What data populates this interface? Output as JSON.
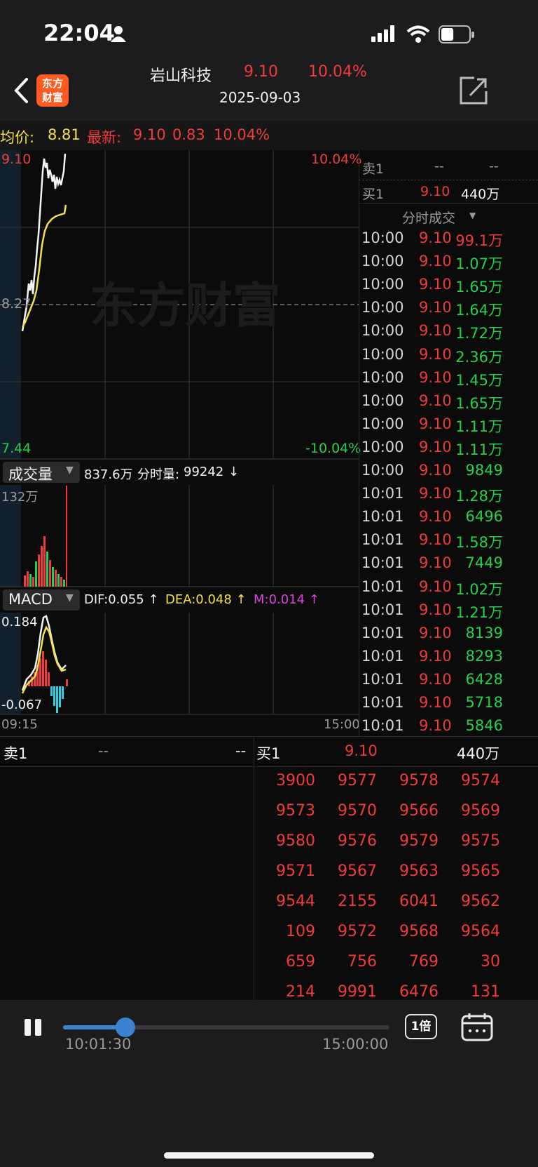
{
  "status": {
    "time": "22:04",
    "battery_level": 0.45
  },
  "header": {
    "stock_name": "岩山科技",
    "price": "9.10",
    "change_pct": "10.04%",
    "date": "2025-09-03",
    "logo_text_1": "东方",
    "logo_text_2": "财富"
  },
  "info_bar": {
    "avg_label": "均价:",
    "avg_value": "8.81",
    "latest_label": "最新:",
    "latest_value": "9.10",
    "change": "0.83",
    "change_pct": "10.04%"
  },
  "price_chart": {
    "top_price": "9.10",
    "mid_price": "8.27",
    "bottom_price": "7.44",
    "top_pct": "10.04%",
    "bottom_pct": "-10.04%",
    "watermark": "东方财富"
  },
  "volume_panel": {
    "selector_label": "成交量",
    "total": "837.6万",
    "fenshi_label": "分时量:",
    "fenshi_value": "99242",
    "fenshi_arrow": "↓",
    "max_label": "132万"
  },
  "macd_panel": {
    "selector_label": "MACD",
    "dif": "DIF:0.055 ↑",
    "dea": "DEA:0.048 ↑",
    "m": "M:0.014 ↑",
    "top_value": "0.184",
    "bottom_value": "-0.067"
  },
  "time_axis": {
    "start": "09:15",
    "end": "15:00"
  },
  "order_book_side": {
    "sell1_label": "卖1",
    "sell1_price": "--",
    "sell1_vol": "--",
    "buy1_label": "买1",
    "buy1_price": "9.10",
    "buy1_vol": "440万"
  },
  "ticks_header": "分时成交",
  "ticks": [
    {
      "time": "10:00",
      "price": "9.10",
      "vol": "99.1万",
      "color": "red"
    },
    {
      "time": "10:00",
      "price": "9.10",
      "vol": "1.07万",
      "color": "green"
    },
    {
      "time": "10:00",
      "price": "9.10",
      "vol": "1.65万",
      "color": "green"
    },
    {
      "time": "10:00",
      "price": "9.10",
      "vol": "1.64万",
      "color": "green"
    },
    {
      "time": "10:00",
      "price": "9.10",
      "vol": "1.72万",
      "color": "green"
    },
    {
      "time": "10:00",
      "price": "9.10",
      "vol": "2.36万",
      "color": "green"
    },
    {
      "time": "10:00",
      "price": "9.10",
      "vol": "1.45万",
      "color": "green"
    },
    {
      "time": "10:00",
      "price": "9.10",
      "vol": "1.65万",
      "color": "green"
    },
    {
      "time": "10:00",
      "price": "9.10",
      "vol": "1.11万",
      "color": "green"
    },
    {
      "time": "10:00",
      "price": "9.10",
      "vol": "1.11万",
      "color": "green"
    },
    {
      "time": "10:00",
      "price": "9.10",
      "vol": "9849",
      "color": "green"
    },
    {
      "time": "10:01",
      "price": "9.10",
      "vol": "1.28万",
      "color": "green"
    },
    {
      "time": "10:01",
      "price": "9.10",
      "vol": "6496",
      "color": "green"
    },
    {
      "time": "10:01",
      "price": "9.10",
      "vol": "1.58万",
      "color": "green"
    },
    {
      "time": "10:01",
      "price": "9.10",
      "vol": "7449",
      "color": "green"
    },
    {
      "time": "10:01",
      "price": "9.10",
      "vol": "1.02万",
      "color": "green"
    },
    {
      "time": "10:01",
      "price": "9.10",
      "vol": "1.21万",
      "color": "green"
    },
    {
      "time": "10:01",
      "price": "9.10",
      "vol": "8139",
      "color": "green"
    },
    {
      "time": "10:01",
      "price": "9.10",
      "vol": "8293",
      "color": "green"
    },
    {
      "time": "10:01",
      "price": "9.10",
      "vol": "6428",
      "color": "green"
    },
    {
      "time": "10:01",
      "price": "9.10",
      "vol": "5718",
      "color": "green"
    },
    {
      "time": "10:01",
      "price": "9.10",
      "vol": "5846",
      "color": "green"
    }
  ],
  "queue": {
    "sell1_label": "卖1",
    "sell1_price": "--",
    "sell1_vol": "--",
    "buy1_label": "买1",
    "buy1_price": "9.10",
    "buy1_vol": "440万",
    "rows": [
      [
        "3900",
        "9577",
        "9578",
        "9574"
      ],
      [
        "9573",
        "9570",
        "9566",
        "9569"
      ],
      [
        "9580",
        "9576",
        "9579",
        "9575"
      ],
      [
        "9571",
        "9567",
        "9563",
        "9565"
      ],
      [
        "9544",
        "2155",
        "6041",
        "9562"
      ],
      [
        "109",
        "9572",
        "9568",
        "9564"
      ],
      [
        "659",
        "756",
        "769",
        "30"
      ],
      [
        "214",
        "9991",
        "6476",
        "131"
      ]
    ]
  },
  "playback": {
    "current_time": "10:01:30",
    "end_time": "15:00:00",
    "progress": 0.19,
    "speed_label": "1倍"
  },
  "colors": {
    "red": "#f03b3b",
    "green": "#27d04a",
    "yellow": "#f2e14a",
    "magenta": "#e040e0",
    "cyan": "#30d0e0"
  }
}
